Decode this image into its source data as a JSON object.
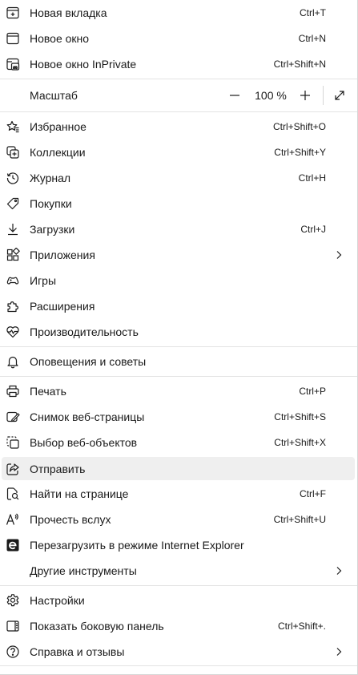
{
  "menu": {
    "new_tab": {
      "label": "Новая вкладка",
      "shortcut": "Ctrl+T",
      "icon": "new-tab-icon"
    },
    "new_window": {
      "label": "Новое окно",
      "shortcut": "Ctrl+N",
      "icon": "new-window-icon"
    },
    "new_inprivate": {
      "label": "Новое окно InPrivate",
      "shortcut": "Ctrl+Shift+N",
      "icon": "inprivate-icon"
    },
    "zoom": {
      "label": "Масштаб",
      "value": "100 %",
      "minus": "—",
      "plus": "+"
    },
    "favorites": {
      "label": "Избранное",
      "shortcut": "Ctrl+Shift+O",
      "icon": "favorites-icon"
    },
    "collections": {
      "label": "Коллекции",
      "shortcut": "Ctrl+Shift+Y",
      "icon": "collections-icon"
    },
    "history": {
      "label": "Журнал",
      "shortcut": "Ctrl+H",
      "icon": "history-icon"
    },
    "shopping": {
      "label": "Покупки",
      "icon": "tag-icon"
    },
    "downloads": {
      "label": "Загрузки",
      "shortcut": "Ctrl+J",
      "icon": "download-icon"
    },
    "apps": {
      "label": "Приложения",
      "icon": "apps-icon"
    },
    "games": {
      "label": "Игры",
      "icon": "games-icon"
    },
    "extensions": {
      "label": "Расширения",
      "icon": "extensions-icon"
    },
    "performance": {
      "label": "Производительность",
      "icon": "performance-icon"
    },
    "notifications": {
      "label": "Оповещения и советы",
      "icon": "bell-icon"
    },
    "print": {
      "label": "Печать",
      "shortcut": "Ctrl+P",
      "icon": "printer-icon"
    },
    "screenshot": {
      "label": "Снимок веб-страницы",
      "shortcut": "Ctrl+Shift+S",
      "icon": "screenshot-icon"
    },
    "web_select": {
      "label": "Выбор веб-объектов",
      "shortcut": "Ctrl+Shift+X",
      "icon": "web-select-icon"
    },
    "share": {
      "label": "Отправить",
      "icon": "share-icon"
    },
    "find": {
      "label": "Найти на странице",
      "shortcut": "Ctrl+F",
      "icon": "find-icon"
    },
    "read_aloud": {
      "label": "Прочесть вслух",
      "shortcut": "Ctrl+Shift+U",
      "icon": "read-aloud-icon"
    },
    "ie_mode": {
      "label": "Перезагрузить в режиме Internet Explorer",
      "icon": "ie-icon"
    },
    "more_tools": {
      "label": "Другие инструменты"
    },
    "settings": {
      "label": "Настройки",
      "icon": "gear-icon"
    },
    "sidebar": {
      "label": "Показать боковую панель",
      "shortcut": "Ctrl+Shift+.",
      "icon": "sidebar-icon"
    },
    "help": {
      "label": "Справка и отзывы",
      "icon": "help-icon"
    }
  }
}
